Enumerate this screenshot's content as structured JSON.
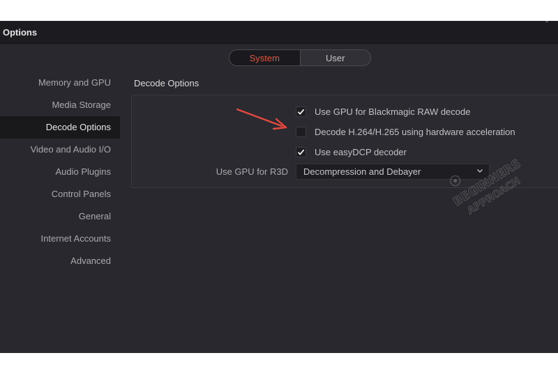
{
  "window": {
    "title": "Options",
    "close_glyph": "˟"
  },
  "tabs": [
    {
      "label": "System",
      "active": true
    },
    {
      "label": "User",
      "active": false
    }
  ],
  "sidebar": {
    "items": [
      {
        "label": "Memory and GPU"
      },
      {
        "label": "Media Storage"
      },
      {
        "label": "Decode Options",
        "active": true
      },
      {
        "label": "Video and Audio I/O"
      },
      {
        "label": "Audio Plugins"
      },
      {
        "label": "Control Panels"
      },
      {
        "label": "General"
      },
      {
        "label": "Internet Accounts"
      },
      {
        "label": "Advanced"
      }
    ]
  },
  "decode": {
    "section_title": "Decode Options",
    "options": [
      {
        "label": "Use GPU for Blackmagic RAW decode",
        "checked": true
      },
      {
        "label": "Decode H.264/H.265 using hardware acceleration",
        "checked": false
      },
      {
        "label": "Use easyDCP decoder",
        "checked": true
      }
    ],
    "r3d_label": "Use GPU for R3D",
    "r3d_value": "Decompression and Debayer"
  },
  "annotation": {
    "arrow_color": "#e64a3f",
    "arrow_icon": "annotation-arrow-icon"
  },
  "watermark": {
    "line1": "BEGINNERS",
    "line2": "APPROACH"
  },
  "colors": {
    "accent": "#e0553f",
    "background": "#28282e",
    "sidebar_active": "#19191c"
  }
}
